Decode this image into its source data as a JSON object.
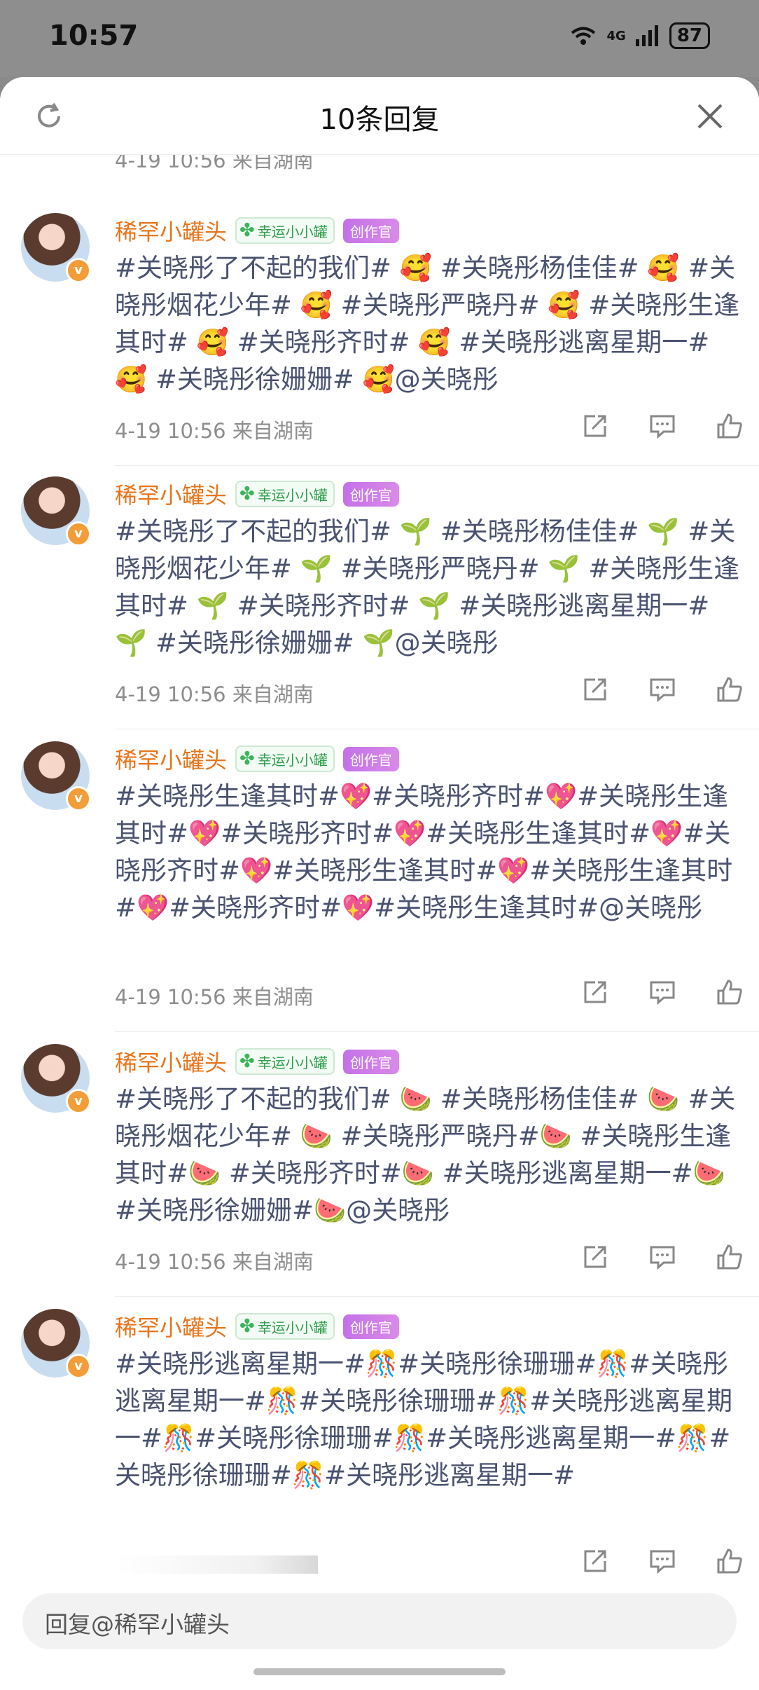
{
  "status": {
    "time": "10:57",
    "network": "4G",
    "battery": "87"
  },
  "header": {
    "title": "10条回复",
    "refresh_icon": "refresh-icon",
    "close_icon": "close-icon"
  },
  "partial_meta": "4-19 10:56 来自湖南",
  "comments": [
    {
      "user": "稀罕小罐头",
      "badge1": "幸运小小罐",
      "badge2": "创作官",
      "text": "#关晓彤了不起的我们# 🥰 #关晓彤杨佳佳# 🥰 #关晓彤烟花少年# 🥰 #关晓彤严晓丹# 🥰 #关晓彤生逢其时# 🥰 #关晓彤齐时# 🥰 #关晓彤逃离星期一# 🥰 #关晓彤徐姗姗# 🥰@关晓彤",
      "meta": "4-19 10:56 来自湖南"
    },
    {
      "user": "稀罕小罐头",
      "badge1": "幸运小小罐",
      "badge2": "创作官",
      "text": "#关晓彤了不起的我们# 🌱 #关晓彤杨佳佳# 🌱 #关晓彤烟花少年# 🌱 #关晓彤严晓丹# 🌱 #关晓彤生逢其时# 🌱 #关晓彤齐时# 🌱 #关晓彤逃离星期一# 🌱 #关晓彤徐姗姗# 🌱@关晓彤",
      "meta": "4-19 10:56 来自湖南"
    },
    {
      "user": "稀罕小罐头",
      "badge1": "幸运小小罐",
      "badge2": "创作官",
      "text": "#关晓彤生逢其时#💖#关晓彤齐时#💖#关晓彤生逢其时#💖#关晓彤齐时#💖#关晓彤生逢其时#💖#关晓彤齐时#💖#关晓彤生逢其时#💖#关晓彤生逢其时#💖#关晓彤齐时#💖#关晓彤生逢其时#@关晓彤",
      "meta": "4-19 10:56 来自湖南"
    },
    {
      "user": "稀罕小罐头",
      "badge1": "幸运小小罐",
      "badge2": "创作官",
      "text": "#关晓彤了不起的我们# 🍉 #关晓彤杨佳佳# 🍉 #关晓彤烟花少年# 🍉 #关晓彤严晓丹#🍉 #关晓彤生逢其时#🍉 #关晓彤齐时#🍉 #关晓彤逃离星期一#🍉 #关晓彤徐姗姗#🍉@关晓彤",
      "meta": "4-19 10:56 来自湖南"
    },
    {
      "user": "稀罕小罐头",
      "badge1": "幸运小小罐",
      "badge2": "创作官",
      "text": "#关晓彤逃离星期一#🎊#关晓彤徐珊珊#🎊#关晓彤逃离星期一#🎊#关晓彤徐珊珊#🎊#关晓彤逃离星期一#🎊#关晓彤徐珊珊#🎊#关晓彤逃离星期一#🎊#关晓彤徐珊珊#🎊#关晓彤逃离星期一#",
      "meta": ""
    }
  ],
  "reply_placeholder": "回复@稀罕小罐头"
}
